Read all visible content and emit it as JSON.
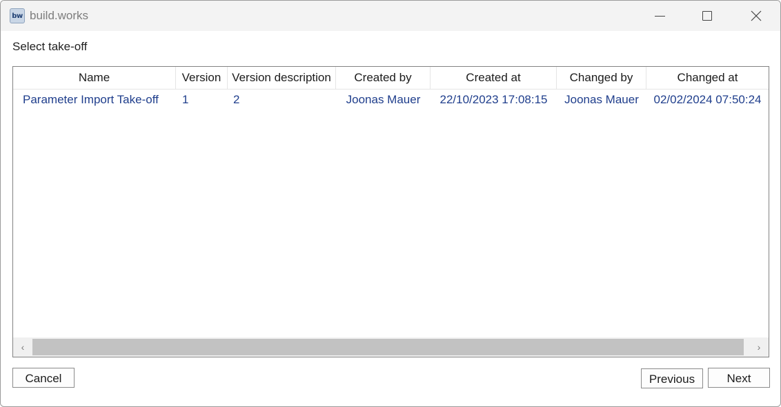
{
  "window": {
    "app_icon_text": "bw",
    "title": "build.works"
  },
  "page": {
    "heading": "Select take-off"
  },
  "table": {
    "columns": [
      "Name",
      "Version",
      "Version description",
      "Created by",
      "Created at",
      "Changed by",
      "Changed at"
    ],
    "rows": [
      [
        "Parameter Import Take-off",
        "1",
        "2",
        "Joonas Mauer",
        "22/10/2023 17:08:15",
        "Joonas Mauer",
        "02/02/2024 07:50:24"
      ]
    ]
  },
  "scrollbar": {
    "left_arrow": "‹",
    "right_arrow": "›"
  },
  "buttons": {
    "cancel": "Cancel",
    "previous": "Previous",
    "next": "Next"
  },
  "colors": {
    "row_text": "#1f3e8c",
    "titlebar_bg": "#f3f3f3"
  }
}
